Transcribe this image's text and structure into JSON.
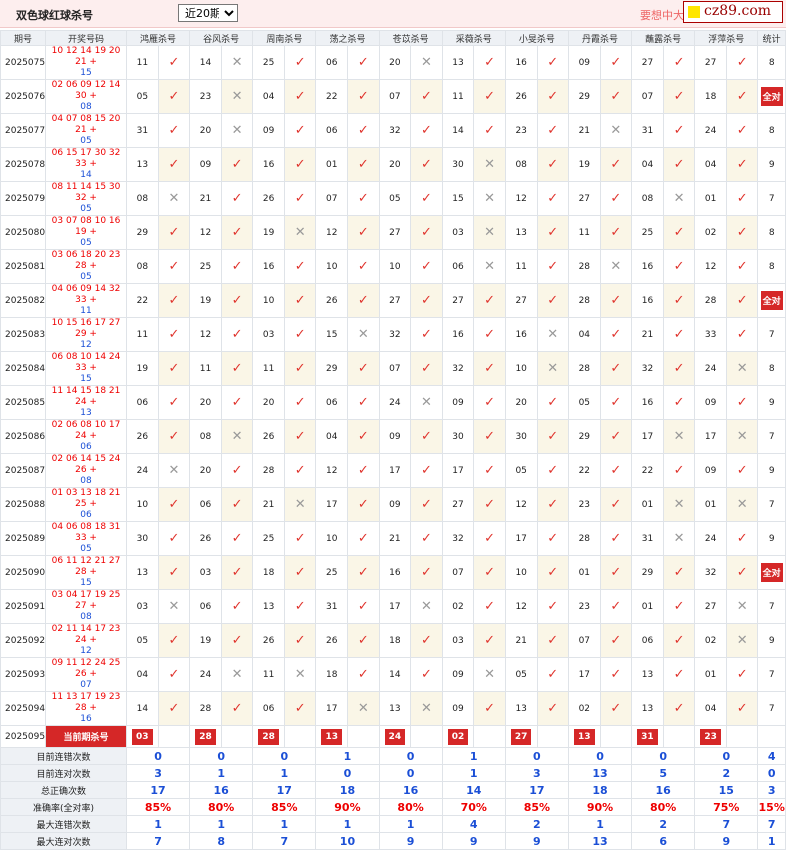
{
  "header": {
    "title": "双色球红球杀号",
    "period_select": {
      "selected": "近20期",
      "options": [
        "近20期"
      ]
    },
    "promo": "要想中大",
    "logo": "cz89.com"
  },
  "columns": [
    "期号",
    "开奖号码",
    "鸿雁杀号",
    "谷风杀号",
    "周南杀号",
    "荡之杀号",
    "苍苡杀号",
    "采薇杀号",
    "小旻杀号",
    "丹霞杀号",
    "蘸露杀号",
    "浮萍杀号",
    "统计"
  ],
  "draws": [
    {
      "period": "2025075",
      "red": "10 12 14 19 20 21 +",
      "blue": "15",
      "kills": [
        [
          "11",
          1
        ],
        [
          "14",
          0
        ],
        [
          "25",
          1
        ],
        [
          "06",
          1
        ],
        [
          "20",
          0
        ],
        [
          "13",
          1
        ],
        [
          "16",
          1
        ],
        [
          "09",
          1
        ],
        [
          "27",
          1
        ],
        [
          "27",
          1
        ]
      ],
      "total": "8"
    },
    {
      "period": "2025076",
      "red": "02 06 09 12 14 30 +",
      "blue": "08",
      "kills": [
        [
          "05",
          1
        ],
        [
          "23",
          0
        ],
        [
          "04",
          1
        ],
        [
          "22",
          1
        ],
        [
          "07",
          1
        ],
        [
          "11",
          1
        ],
        [
          "26",
          1
        ],
        [
          "29",
          1
        ],
        [
          "07",
          1
        ],
        [
          "18",
          1
        ]
      ],
      "total": "全对"
    },
    {
      "period": "2025077",
      "red": "04 07 08 15 20 21 +",
      "blue": "05",
      "kills": [
        [
          "31",
          1
        ],
        [
          "20",
          0
        ],
        [
          "09",
          1
        ],
        [
          "06",
          1
        ],
        [
          "32",
          1
        ],
        [
          "14",
          1
        ],
        [
          "23",
          1
        ],
        [
          "21",
          0
        ],
        [
          "31",
          1
        ],
        [
          "24",
          1
        ]
      ],
      "total": "8"
    },
    {
      "period": "2025078",
      "red": "06 15 17 30 32 33 +",
      "blue": "14",
      "kills": [
        [
          "13",
          1
        ],
        [
          "09",
          1
        ],
        [
          "16",
          1
        ],
        [
          "01",
          1
        ],
        [
          "20",
          1
        ],
        [
          "30",
          0
        ],
        [
          "08",
          1
        ],
        [
          "19",
          1
        ],
        [
          "04",
          1
        ],
        [
          "04",
          1
        ]
      ],
      "total": "9"
    },
    {
      "period": "2025079",
      "red": "08 11 14 15 30 32 +",
      "blue": "05",
      "kills": [
        [
          "08",
          0
        ],
        [
          "21",
          1
        ],
        [
          "26",
          1
        ],
        [
          "07",
          1
        ],
        [
          "05",
          1
        ],
        [
          "15",
          0
        ],
        [
          "12",
          1
        ],
        [
          "27",
          1
        ],
        [
          "08",
          0
        ],
        [
          "01",
          1
        ]
      ],
      "total": "7"
    },
    {
      "period": "2025080",
      "red": "03 07 08 10 16 19 +",
      "blue": "05",
      "kills": [
        [
          "29",
          1
        ],
        [
          "12",
          1
        ],
        [
          "19",
          0
        ],
        [
          "12",
          1
        ],
        [
          "27",
          1
        ],
        [
          "03",
          0
        ],
        [
          "13",
          1
        ],
        [
          "11",
          1
        ],
        [
          "25",
          1
        ],
        [
          "02",
          1
        ]
      ],
      "total": "8"
    },
    {
      "period": "2025081",
      "red": "03 06 18 20 23 28 +",
      "blue": "05",
      "kills": [
        [
          "08",
          1
        ],
        [
          "25",
          1
        ],
        [
          "16",
          1
        ],
        [
          "10",
          1
        ],
        [
          "10",
          1
        ],
        [
          "06",
          0
        ],
        [
          "11",
          1
        ],
        [
          "28",
          0
        ],
        [
          "16",
          1
        ],
        [
          "12",
          1
        ]
      ],
      "total": "8"
    },
    {
      "period": "2025082",
      "red": "04 06 09 14 32 33 +",
      "blue": "11",
      "kills": [
        [
          "22",
          1
        ],
        [
          "19",
          1
        ],
        [
          "10",
          1
        ],
        [
          "26",
          1
        ],
        [
          "27",
          1
        ],
        [
          "27",
          1
        ],
        [
          "27",
          1
        ],
        [
          "28",
          1
        ],
        [
          "16",
          1
        ],
        [
          "28",
          1
        ]
      ],
      "total": "全对"
    },
    {
      "period": "2025083",
      "red": "10 15 16 17 27 29 +",
      "blue": "12",
      "kills": [
        [
          "11",
          1
        ],
        [
          "12",
          1
        ],
        [
          "03",
          1
        ],
        [
          "15",
          0
        ],
        [
          "32",
          1
        ],
        [
          "16",
          1
        ],
        [
          "16",
          0
        ],
        [
          "04",
          1
        ],
        [
          "21",
          1
        ],
        [
          "33",
          1
        ]
      ],
      "total": "7"
    },
    {
      "period": "2025084",
      "red": "06 08 10 14 24 33 +",
      "blue": "15",
      "kills": [
        [
          "19",
          1
        ],
        [
          "11",
          1
        ],
        [
          "11",
          1
        ],
        [
          "29",
          1
        ],
        [
          "07",
          1
        ],
        [
          "32",
          1
        ],
        [
          "10",
          0
        ],
        [
          "28",
          1
        ],
        [
          "32",
          1
        ],
        [
          "24",
          0
        ]
      ],
      "total": "8"
    },
    {
      "period": "2025085",
      "red": "11 14 15 18 21 24 +",
      "blue": "13",
      "kills": [
        [
          "06",
          1
        ],
        [
          "20",
          1
        ],
        [
          "20",
          1
        ],
        [
          "06",
          1
        ],
        [
          "24",
          0
        ],
        [
          "09",
          1
        ],
        [
          "20",
          1
        ],
        [
          "05",
          1
        ],
        [
          "16",
          1
        ],
        [
          "09",
          1
        ]
      ],
      "total": "9"
    },
    {
      "period": "2025086",
      "red": "02 06 08 10 17 24 +",
      "blue": "06",
      "kills": [
        [
          "26",
          1
        ],
        [
          "08",
          0
        ],
        [
          "26",
          1
        ],
        [
          "04",
          1
        ],
        [
          "09",
          1
        ],
        [
          "30",
          1
        ],
        [
          "30",
          1
        ],
        [
          "29",
          1
        ],
        [
          "17",
          0
        ],
        [
          "17",
          0
        ]
      ],
      "total": "7"
    },
    {
      "period": "2025087",
      "red": "02 06 14 15 24 26 +",
      "blue": "08",
      "kills": [
        [
          "24",
          0
        ],
        [
          "20",
          1
        ],
        [
          "28",
          1
        ],
        [
          "12",
          1
        ],
        [
          "17",
          1
        ],
        [
          "17",
          1
        ],
        [
          "05",
          1
        ],
        [
          "22",
          1
        ],
        [
          "22",
          1
        ],
        [
          "09",
          1
        ]
      ],
      "total": "9"
    },
    {
      "period": "2025088",
      "red": "01 03 13 18 21 25 +",
      "blue": "06",
      "kills": [
        [
          "10",
          1
        ],
        [
          "06",
          1
        ],
        [
          "21",
          0
        ],
        [
          "17",
          1
        ],
        [
          "09",
          1
        ],
        [
          "27",
          1
        ],
        [
          "12",
          1
        ],
        [
          "23",
          1
        ],
        [
          "01",
          0
        ],
        [
          "01",
          0
        ]
      ],
      "total": "7"
    },
    {
      "period": "2025089",
      "red": "04 06 08 18 31 33 +",
      "blue": "05",
      "kills": [
        [
          "30",
          1
        ],
        [
          "26",
          1
        ],
        [
          "25",
          1
        ],
        [
          "10",
          1
        ],
        [
          "21",
          1
        ],
        [
          "32",
          1
        ],
        [
          "17",
          1
        ],
        [
          "28",
          1
        ],
        [
          "31",
          0
        ],
        [
          "24",
          1
        ]
      ],
      "total": "9"
    },
    {
      "period": "2025090",
      "red": "06 11 12 21 27 28 +",
      "blue": "15",
      "kills": [
        [
          "13",
          1
        ],
        [
          "03",
          1
        ],
        [
          "18",
          1
        ],
        [
          "25",
          1
        ],
        [
          "16",
          1
        ],
        [
          "07",
          1
        ],
        [
          "10",
          1
        ],
        [
          "01",
          1
        ],
        [
          "29",
          1
        ],
        [
          "32",
          1
        ]
      ],
      "total": "全对"
    },
    {
      "period": "2025091",
      "red": "03 04 17 19 25 27 +",
      "blue": "08",
      "kills": [
        [
          "03",
          0
        ],
        [
          "06",
          1
        ],
        [
          "13",
          1
        ],
        [
          "31",
          1
        ],
        [
          "17",
          0
        ],
        [
          "02",
          1
        ],
        [
          "12",
          1
        ],
        [
          "23",
          1
        ],
        [
          "01",
          1
        ],
        [
          "27",
          0
        ]
      ],
      "total": "7"
    },
    {
      "period": "2025092",
      "red": "02 11 14 17 23 24 +",
      "blue": "12",
      "kills": [
        [
          "05",
          1
        ],
        [
          "19",
          1
        ],
        [
          "26",
          1
        ],
        [
          "26",
          1
        ],
        [
          "18",
          1
        ],
        [
          "03",
          1
        ],
        [
          "21",
          1
        ],
        [
          "07",
          1
        ],
        [
          "06",
          1
        ],
        [
          "02",
          0
        ]
      ],
      "total": "9"
    },
    {
      "period": "2025093",
      "red": "09 11 12 24 25 26 +",
      "blue": "07",
      "kills": [
        [
          "04",
          1
        ],
        [
          "24",
          0
        ],
        [
          "11",
          0
        ],
        [
          "18",
          1
        ],
        [
          "14",
          1
        ],
        [
          "09",
          0
        ],
        [
          "05",
          1
        ],
        [
          "17",
          1
        ],
        [
          "13",
          1
        ],
        [
          "01",
          1
        ]
      ],
      "total": "7"
    },
    {
      "period": "2025094",
      "red": "11 13 17 19 23 28 +",
      "blue": "16",
      "kills": [
        [
          "14",
          1
        ],
        [
          "28",
          1
        ],
        [
          "06",
          1
        ],
        [
          "17",
          0
        ],
        [
          "13",
          0
        ],
        [
          "09",
          1
        ],
        [
          "13",
          1
        ],
        [
          "02",
          1
        ],
        [
          "13",
          1
        ],
        [
          "04",
          1
        ]
      ],
      "total": "7"
    }
  ],
  "current": {
    "period": "2025095",
    "label": "当前期杀号",
    "kills": [
      "03",
      "28",
      "28",
      "13",
      "24",
      "02",
      "27",
      "13",
      "31",
      "23"
    ]
  },
  "stats": [
    {
      "label": "目前连错次数",
      "values": [
        "0",
        "0",
        "0",
        "1",
        "0",
        "1",
        "0",
        "0",
        "0",
        "0",
        "4"
      ]
    },
    {
      "label": "目前连对次数",
      "values": [
        "3",
        "1",
        "1",
        "0",
        "0",
        "1",
        "3",
        "13",
        "5",
        "2",
        "0"
      ]
    },
    {
      "label": "总正确次数",
      "values": [
        "17",
        "16",
        "17",
        "18",
        "16",
        "14",
        "17",
        "18",
        "16",
        "15",
        "3"
      ]
    },
    {
      "label": "准确率(全对率)",
      "values": [
        "85%",
        "80%",
        "85%",
        "90%",
        "80%",
        "70%",
        "85%",
        "90%",
        "80%",
        "75%",
        "15%"
      ]
    },
    {
      "label": "最大连错次数",
      "values": [
        "1",
        "1",
        "1",
        "1",
        "1",
        "4",
        "2",
        "1",
        "2",
        "7",
        "7"
      ]
    },
    {
      "label": "最大连对次数",
      "values": [
        "7",
        "8",
        "7",
        "10",
        "9",
        "9",
        "9",
        "13",
        "6",
        "9",
        "1"
      ]
    }
  ],
  "colors": {
    "accent_red": "#d52727",
    "check_red": "#e0342d",
    "blue_number": "#1b4fd6",
    "header_bg": "#eef1f5",
    "alt_row": "#faf6e7"
  },
  "icons": {
    "correct": "check-icon",
    "wrong": "cross-icon"
  }
}
